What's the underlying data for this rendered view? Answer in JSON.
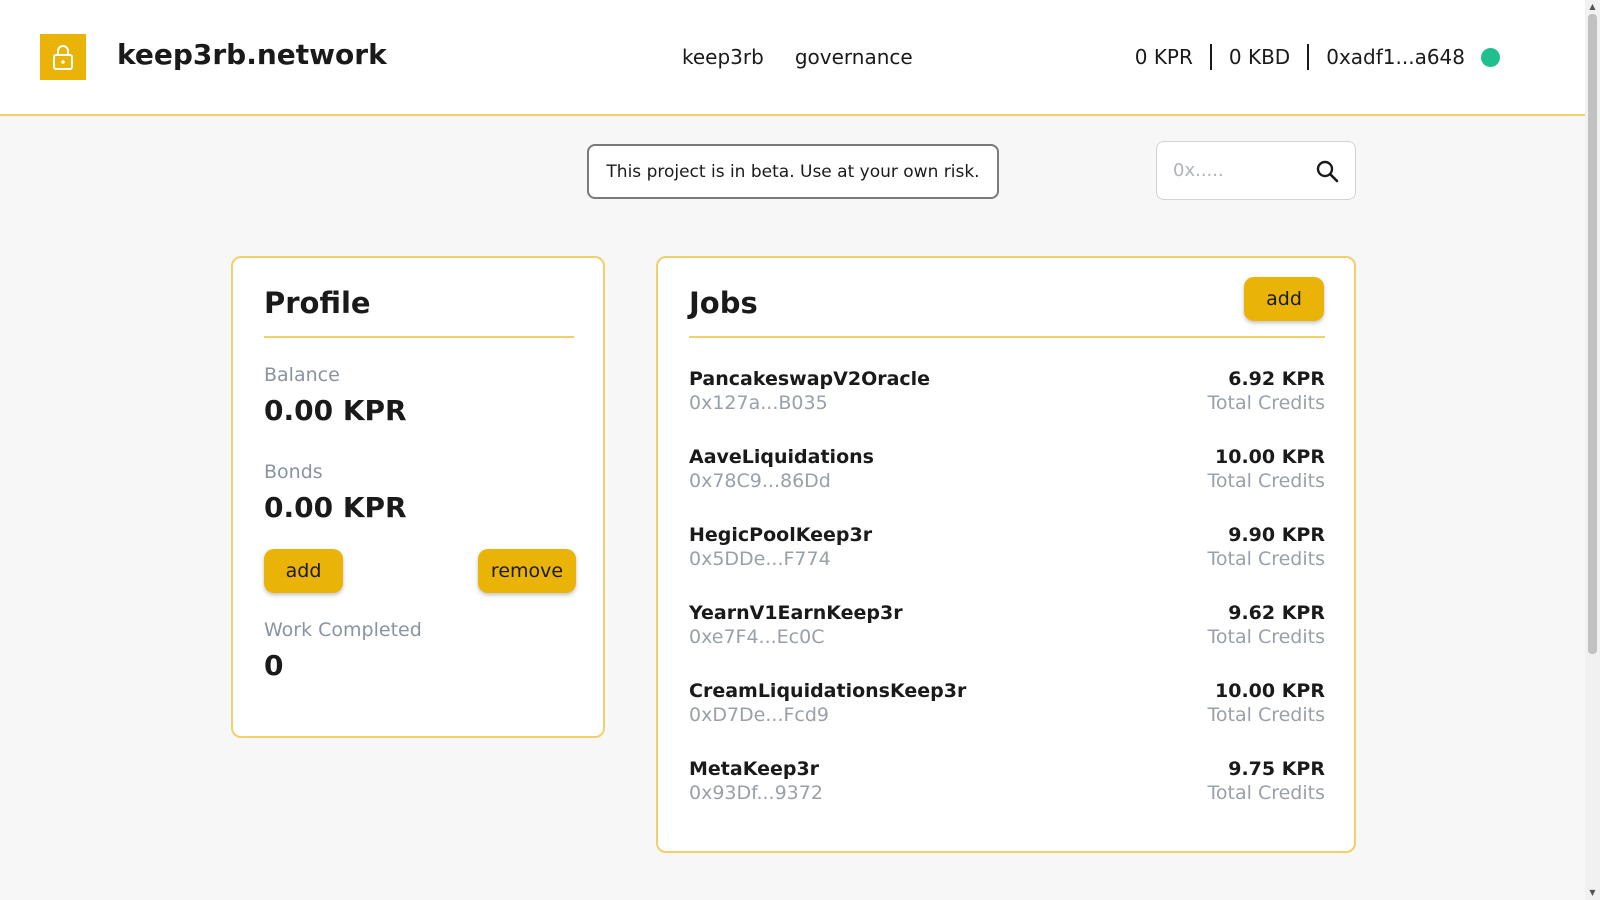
{
  "header": {
    "brand": "keep3rb.network",
    "nav": [
      "keep3rb",
      "governance"
    ],
    "wallet": {
      "kpr": "0 KPR",
      "kbd": "0 KBD",
      "address": "0xadf1...a648",
      "status_color": "#1fbf8f"
    }
  },
  "notice": "This project is in beta. Use at your own risk.",
  "search": {
    "placeholder": "0x....."
  },
  "profile": {
    "title": "Profile",
    "balance_label": "Balance",
    "balance_value": "0.00 KPR",
    "bonds_label": "Bonds",
    "bonds_value": "0.00 KPR",
    "add_label": "add",
    "remove_label": "remove",
    "work_label": "Work Completed",
    "work_value": "0"
  },
  "jobs": {
    "title": "Jobs",
    "add_label": "add",
    "items": [
      {
        "name": "PancakeswapV2Oracle",
        "address": "0x127a...B035",
        "credits": "6.92 KPR",
        "credits_label": "Total Credits"
      },
      {
        "name": "AaveLiquidations",
        "address": "0x78C9...86Dd",
        "credits": "10.00 KPR",
        "credits_label": "Total Credits"
      },
      {
        "name": "HegicPoolKeep3r",
        "address": "0x5DDe...F774",
        "credits": "9.90 KPR",
        "credits_label": "Total Credits"
      },
      {
        "name": "YearnV1EarnKeep3r",
        "address": "0xe7F4...Ec0C",
        "credits": "9.62 KPR",
        "credits_label": "Total Credits"
      },
      {
        "name": "CreamLiquidationsKeep3r",
        "address": "0xD7De...Fcd9",
        "credits": "10.00 KPR",
        "credits_label": "Total Credits"
      },
      {
        "name": "MetaKeep3r",
        "address": "0x93Df...9372",
        "credits": "9.75 KPR",
        "credits_label": "Total Credits"
      }
    ]
  },
  "colors": {
    "accent": "#e9b308",
    "border_accent": "#f3cf6a",
    "muted_text": "#9aa0a8"
  },
  "icons": [
    "lock-icon",
    "search-icon",
    "status-dot"
  ]
}
